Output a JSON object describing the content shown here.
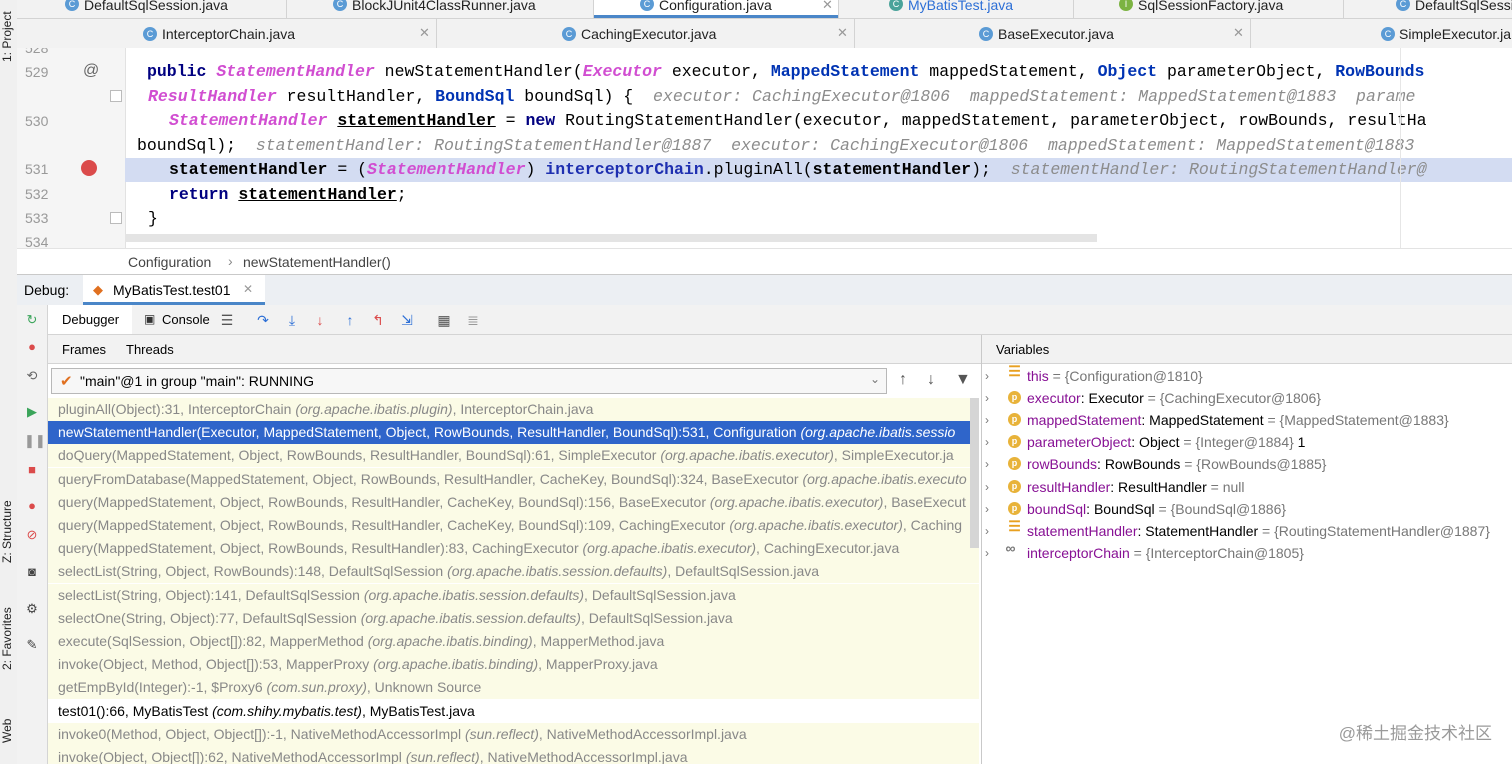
{
  "left_strip": {
    "project_label": "1: Project",
    "structure_label": "Z: Structure",
    "favorites_label": "2: Favorites",
    "web_label": "Web"
  },
  "tabs_row1": [
    {
      "label": "DefaultSqlSession.java",
      "icon": "C"
    },
    {
      "label": "BlockJUnit4ClassRunner.java",
      "icon": "C"
    },
    {
      "label": "Configuration.java",
      "icon": "C"
    },
    {
      "label": "MyBatisTest.java",
      "icon": "C"
    },
    {
      "label": "SqlSessionFactory.java",
      "icon": "I"
    },
    {
      "label": "DefaultSqlSessi",
      "icon": "C"
    }
  ],
  "tabs_row2": [
    {
      "label": "InterceptorChain.java",
      "icon": "C"
    },
    {
      "label": "CachingExecutor.java",
      "icon": "C"
    },
    {
      "label": "BaseExecutor.java",
      "icon": "C"
    },
    {
      "label": "SimpleExecutor.ja",
      "icon": "C"
    }
  ],
  "editor": {
    "line_numbers": [
      "528",
      "529",
      "",
      "530",
      "",
      "531",
      "532",
      "533",
      "534"
    ],
    "line1": {
      "public": "public",
      "return_type": "StatementHandler",
      "name": "newStatementHandler(",
      "p1_type": "Executor",
      "p1": " executor, ",
      "p2_type": "MappedStatement",
      "p2": " mappedStatement, ",
      "p3_type": "Object",
      "p3": " parameterObject, ",
      "p4_type": "RowBounds"
    },
    "line2": {
      "t1": "ResultHandler",
      "p1": " resultHandler, ",
      "t2": "BoundSql",
      "p2": " boundSql) {",
      "hint": "  executor: CachingExecutor@1806  mappedStatement: MappedStatement@1883  parame"
    },
    "line3": {
      "t1": "StatementHandler",
      "var": "statementHandler",
      "eq": " = ",
      "new": "new",
      "rest": " RoutingStatementHandler(executor, mappedStatement, parameterObject, rowBounds, resultHa"
    },
    "line4": {
      "code": "boundSql);",
      "hint": "  statementHandler: RoutingStatementHandler@1887  executor: CachingExecutor@1806  mappedStatement: MappedStatement@1883"
    },
    "line5": {
      "var": "statementHandler",
      "eq": " = (",
      "cast": "StatementHandler",
      "close": ") ",
      "chain": "interceptorChain",
      "call": ".pluginAll(",
      "arg": "statementHandler",
      "end": ");",
      "hint": "  statementHandler: RoutingStatementHandler@"
    },
    "line6": {
      "kw": "return",
      "var": "statementHandler",
      "end": ";"
    },
    "line7": {
      "code": "}"
    }
  },
  "breadcrumb": {
    "class": "Configuration",
    "sep": "›",
    "method": "newStatementHandler()"
  },
  "debug": {
    "label": "Debug:",
    "session_tab": "MyBatisTest.test01",
    "debugger_tab": "Debugger",
    "console_tab": "Console",
    "frames_tab": "Frames",
    "threads_tab": "Threads",
    "variables_label": "Variables",
    "thread_select": "\"main\"@1 in group \"main\": RUNNING"
  },
  "frames": [
    {
      "sig": "pluginAll(Object):31, InterceptorChain ",
      "pkg": "(org.apache.ibatis.plugin)",
      "file": ", InterceptorChain.java",
      "kind": "lib"
    },
    {
      "sig": "newStatementHandler(Executor, MappedStatement, Object, RowBounds, ResultHandler, BoundSql):531, Configuration ",
      "pkg": "(org.apache.ibatis.sessio",
      "file": "",
      "kind": "sel"
    },
    {
      "sig": "doQuery(MappedStatement, Object, RowBounds, ResultHandler, BoundSql):61, SimpleExecutor ",
      "pkg": "(org.apache.ibatis.executor)",
      "file": ", SimpleExecutor.ja",
      "kind": "lib"
    },
    {
      "sig": "queryFromDatabase(MappedStatement, Object, RowBounds, ResultHandler, CacheKey, BoundSql):324, BaseExecutor ",
      "pkg": "(org.apache.ibatis.executo",
      "file": "",
      "kind": "lib"
    },
    {
      "sig": "query(MappedStatement, Object, RowBounds, ResultHandler, CacheKey, BoundSql):156, BaseExecutor ",
      "pkg": "(org.apache.ibatis.executor)",
      "file": ", BaseExecut",
      "kind": "lib"
    },
    {
      "sig": "query(MappedStatement, Object, RowBounds, ResultHandler, CacheKey, BoundSql):109, CachingExecutor ",
      "pkg": "(org.apache.ibatis.executor)",
      "file": ", Caching",
      "kind": "lib"
    },
    {
      "sig": "query(MappedStatement, Object, RowBounds, ResultHandler):83, CachingExecutor ",
      "pkg": "(org.apache.ibatis.executor)",
      "file": ", CachingExecutor.java",
      "kind": "lib"
    },
    {
      "sig": "selectList(String, Object, RowBounds):148, DefaultSqlSession ",
      "pkg": "(org.apache.ibatis.session.defaults)",
      "file": ", DefaultSqlSession.java",
      "kind": "lib"
    },
    {
      "sig": "selectList(String, Object):141, DefaultSqlSession ",
      "pkg": "(org.apache.ibatis.session.defaults)",
      "file": ", DefaultSqlSession.java",
      "kind": "lib"
    },
    {
      "sig": "selectOne(String, Object):77, DefaultSqlSession ",
      "pkg": "(org.apache.ibatis.session.defaults)",
      "file": ", DefaultSqlSession.java",
      "kind": "lib"
    },
    {
      "sig": "execute(SqlSession, Object[]):82, MapperMethod ",
      "pkg": "(org.apache.ibatis.binding)",
      "file": ", MapperMethod.java",
      "kind": "lib"
    },
    {
      "sig": "invoke(Object, Method, Object[]):53, MapperProxy ",
      "pkg": "(org.apache.ibatis.binding)",
      "file": ", MapperProxy.java",
      "kind": "lib"
    },
    {
      "sig": "getEmpById(Integer):-1, $Proxy6 ",
      "pkg": "(com.sun.proxy)",
      "file": ", Unknown Source",
      "kind": "lib"
    },
    {
      "sig": "test01():66, MyBatisTest ",
      "pkg": "(com.shihy.mybatis.test)",
      "file": ", MyBatisTest.java",
      "kind": "user"
    },
    {
      "sig": "invoke0(Method, Object, Object[]):-1, NativeMethodAccessorImpl ",
      "pkg": "(sun.reflect)",
      "file": ", NativeMethodAccessorImpl.java",
      "kind": "lib"
    },
    {
      "sig": "invoke(Object, Object[]):62, NativeMethodAccessorImpl ",
      "pkg": "(sun.reflect)",
      "file": ", NativeMethodAccessorImpl.java",
      "kind": "lib"
    }
  ],
  "variables": [
    {
      "icon": "field-list",
      "name": "this",
      "type": "",
      "value": " = {Configuration@1810}",
      "extra": ""
    },
    {
      "icon": "p",
      "name": "executor",
      "type": ": Executor",
      "value": "  = {CachingExecutor@1806}",
      "extra": ""
    },
    {
      "icon": "p",
      "name": "mappedStatement",
      "type": ": MappedStatement",
      "value": "  = {MappedStatement@1883}",
      "extra": ""
    },
    {
      "icon": "p",
      "name": "parameterObject",
      "type": ": Object",
      "value": "  = {Integer@1884}",
      "extra": " 1"
    },
    {
      "icon": "p",
      "name": "rowBounds",
      "type": ": RowBounds",
      "value": "  = {RowBounds@1885}",
      "extra": ""
    },
    {
      "icon": "p",
      "name": "resultHandler",
      "type": ": ResultHandler",
      "value": "  = null",
      "extra": ""
    },
    {
      "icon": "p",
      "name": "boundSql",
      "type": ": BoundSql",
      "value": "  = {BoundSql@1886}",
      "extra": ""
    },
    {
      "icon": "field-list",
      "name": "statementHandler",
      "type": ": StatementHandler",
      "value": "  = {RoutingStatementHandler@1887}",
      "extra": ""
    },
    {
      "icon": "oo",
      "name": "interceptorChain",
      "type": "",
      "value": " = {InterceptorChain@1805}",
      "extra": ""
    }
  ],
  "watermark": "@稀土掘金技术社区",
  "colors": {
    "accent": "#2f65ca",
    "keyword": "#000080",
    "type": "#d14ed1",
    "hint": "#8c8c8c"
  }
}
